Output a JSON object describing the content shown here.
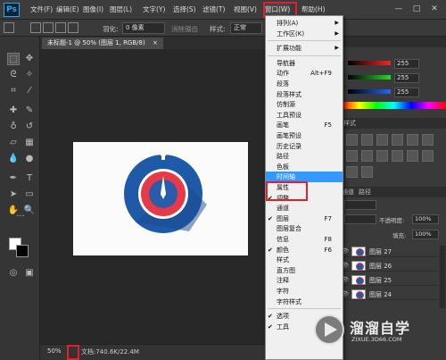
{
  "app": {
    "logo": "Ps"
  },
  "menubar": {
    "items": [
      "文件(F)",
      "编辑(E)",
      "图像(I)",
      "图层(L)",
      "文字(Y)",
      "选择(S)",
      "滤镜(T)",
      "视图(V)",
      "窗口(W)",
      "帮助(H)"
    ],
    "active": "窗口(W)"
  },
  "window_controls": {
    "minimize": "—",
    "restore": "□",
    "close": "✕"
  },
  "options_bar": {
    "feather_label": "羽化:",
    "feather_value": "0 像素",
    "antialias_label": "消除锯齿",
    "style_label": "样式:",
    "style_value": "正常"
  },
  "document": {
    "tab_title": "未标题-1 @ 50% (图层 1, RGB/8)",
    "tab_close": "×",
    "canvas_bg": "#fbfbfb",
    "icon_colors": {
      "outer": "#1e5aa8",
      "ring": "#e8394a",
      "inner": "#2b5caa",
      "marker": "#ffffff"
    }
  },
  "status": {
    "zoom": "50%",
    "doc_info": "文档:740.6K/22.4M"
  },
  "color_panel": {
    "values": [
      "255",
      "255",
      "255"
    ],
    "slider_colors": [
      "#ff2222",
      "#22dd22",
      "#2266ff"
    ]
  },
  "styles_panel": {
    "label": "样式"
  },
  "layers_panel": {
    "tabs": [
      "通道",
      "路径"
    ],
    "opacity_label": "不透明度:",
    "opacity_value": "100%",
    "fill_label": "填充:",
    "fill_value": "100%",
    "layers": [
      "图层 27",
      "图层 26",
      "图层 25",
      "图层 24"
    ]
  },
  "window_menu": {
    "items": [
      {
        "label": "排列(A)",
        "submenu": true
      },
      {
        "label": "工作区(K)",
        "submenu": true
      },
      {
        "sep": true
      },
      {
        "label": "扩展功能",
        "submenu": true
      },
      {
        "sep": true
      },
      {
        "label": "导航器"
      },
      {
        "label": "动作",
        "shortcut": "Alt+F9"
      },
      {
        "label": "段落"
      },
      {
        "label": "段落样式"
      },
      {
        "label": "仿制源"
      },
      {
        "label": "工具预设"
      },
      {
        "label": "画笔",
        "shortcut": "F5"
      },
      {
        "label": "画笔预设"
      },
      {
        "label": "历史记录"
      },
      {
        "label": "路径"
      },
      {
        "label": "色板"
      },
      {
        "label": "时间轴",
        "highlighted": true
      },
      {
        "label": "属性"
      },
      {
        "label": "调整",
        "checked": true
      },
      {
        "label": "通道"
      },
      {
        "label": "图层",
        "shortcut": "F7",
        "checked": true
      },
      {
        "label": "图层复合"
      },
      {
        "label": "信息",
        "shortcut": "F8"
      },
      {
        "label": "颜色",
        "shortcut": "F6",
        "checked": true
      },
      {
        "label": "样式"
      },
      {
        "label": "直方图"
      },
      {
        "label": "注释"
      },
      {
        "label": "字符"
      },
      {
        "label": "字符样式"
      },
      {
        "sep": true
      },
      {
        "label": "选项",
        "checked": true
      },
      {
        "label": "工具",
        "checked": true
      }
    ]
  },
  "watermark": {
    "title": "溜溜自学",
    "url": "ZIXUE.3D66.COM"
  }
}
